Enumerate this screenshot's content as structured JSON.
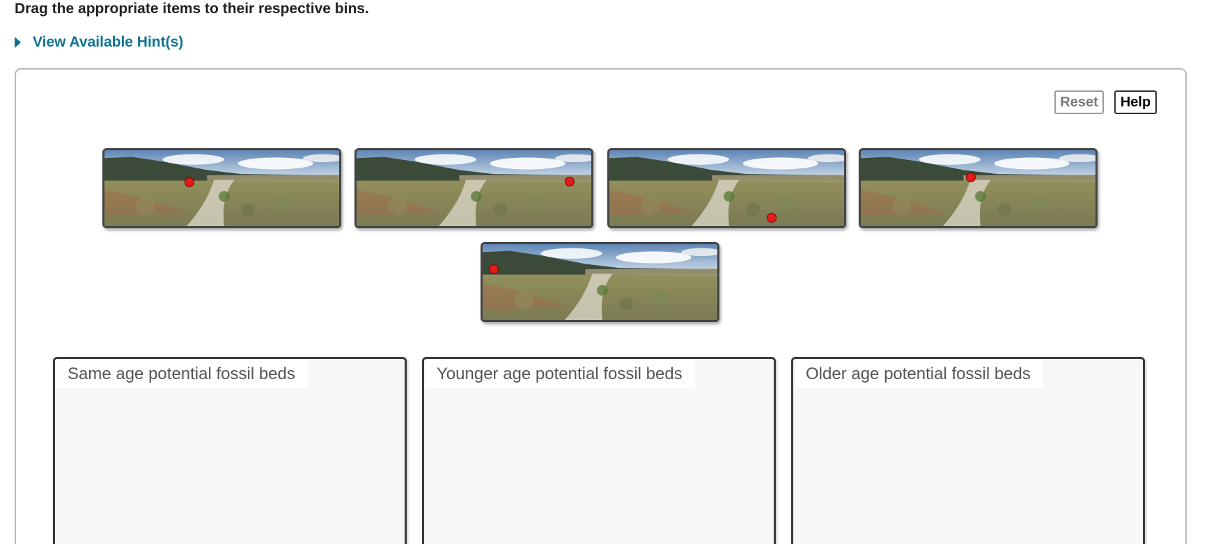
{
  "instruction": "Drag the appropriate items to their respective bins.",
  "hint": {
    "label": "View Available Hint(s)"
  },
  "toolbar": {
    "reset_label": "Reset",
    "help_label": "Help"
  },
  "items": [
    {
      "name": "landscape-photo-1",
      "marker_icon": "red-dot-marker"
    },
    {
      "name": "landscape-photo-2",
      "marker_icon": "red-dot-marker"
    },
    {
      "name": "landscape-photo-3",
      "marker_icon": "red-dot-marker"
    },
    {
      "name": "landscape-photo-4",
      "marker_icon": "red-dot-marker"
    },
    {
      "name": "landscape-photo-5",
      "marker_icon": "red-dot-marker"
    }
  ],
  "bins": [
    {
      "title": "Same age potential fossil beds"
    },
    {
      "title": "Younger age potential fossil beds"
    },
    {
      "title": "Older age potential fossil beds"
    }
  ],
  "colors": {
    "link": "#0f7391",
    "marker": "#e31b1b",
    "bin_background": "#f7f7f7"
  }
}
